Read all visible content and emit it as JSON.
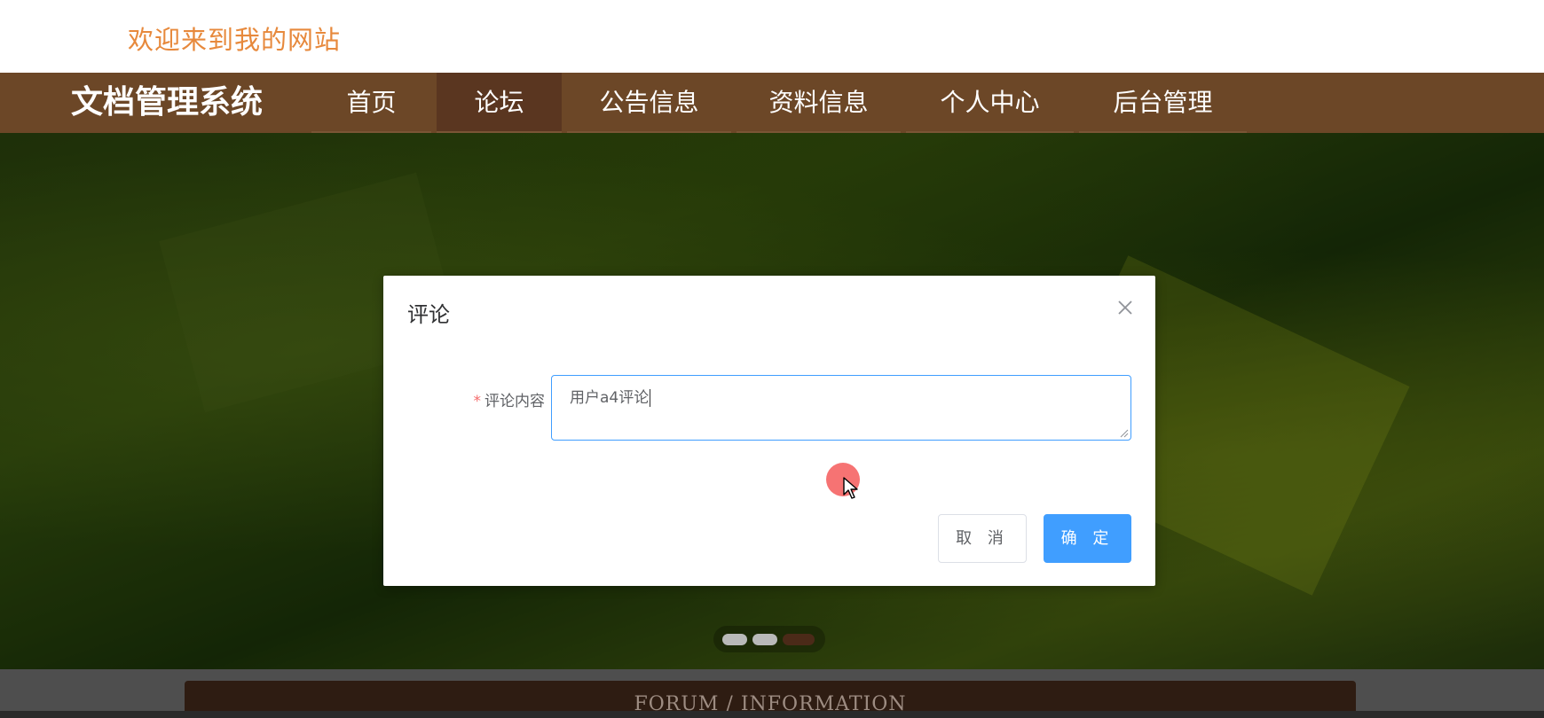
{
  "header": {
    "welcome_text": "欢迎来到我的网站",
    "welcome_color": "#e7893c"
  },
  "nav": {
    "brand": "文档管理系统",
    "background": "#6c4727",
    "items": [
      {
        "label": "首页",
        "active": false
      },
      {
        "label": "论坛",
        "active": true
      },
      {
        "label": "公告信息",
        "active": false
      },
      {
        "label": "资料信息",
        "active": false
      },
      {
        "label": "个人中心",
        "active": false
      },
      {
        "label": "后台管理",
        "active": false
      }
    ]
  },
  "carousel": {
    "slide_count": 3,
    "active_slide": 3
  },
  "section": {
    "title": "FORUM / INFORMATION"
  },
  "dialog": {
    "title": "评论",
    "close_icon": "close-icon",
    "field_required_mark": "*",
    "field_label": "评论内容",
    "field_value": "用户a4评论",
    "cancel_label": "取 消",
    "confirm_label": "确 定",
    "primary_color": "#409eff",
    "required_color": "#f56c6c"
  }
}
